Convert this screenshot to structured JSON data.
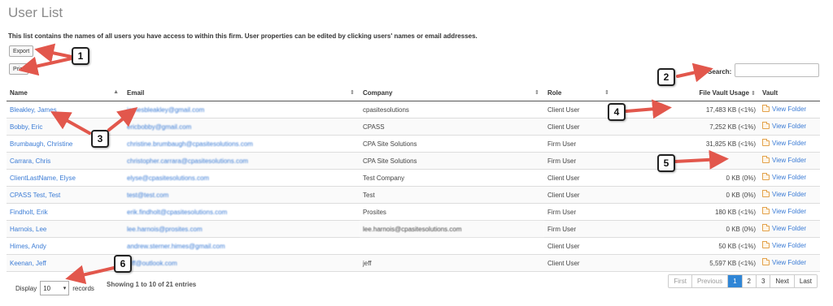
{
  "page": {
    "title": "User List",
    "description": "This list contains the names of all users you have access to within this firm. User properties can be edited by clicking users' names or email addresses."
  },
  "toolbar": {
    "export_label": "Export",
    "print_label": "Print"
  },
  "search": {
    "label": "Search:",
    "value": ""
  },
  "table": {
    "columns": [
      "Name",
      "Email",
      "Company",
      "Role",
      "File Vault Usage",
      "Vault"
    ],
    "rows": [
      {
        "name": "Bleakley, James",
        "email": "jamesbleakley@gmail.com",
        "company": "cpasitesolutions",
        "role": "Client User",
        "usage": "17,483 KB (<1%)",
        "vault": "View Folder"
      },
      {
        "name": "Bobby, Eric",
        "email": "ericbobby@gmail.com",
        "company": "CPASS",
        "role": "Client User",
        "usage": "7,252 KB (<1%)",
        "vault": "View Folder"
      },
      {
        "name": "Brumbaugh, Christine",
        "email": "christine.brumbaugh@cpasitesolutions.com",
        "company": "CPA Site Solutions",
        "role": "Firm User",
        "usage": "31,825 KB (<1%)",
        "vault": "View Folder"
      },
      {
        "name": "Carrara, Chris",
        "email": "christopher.carrara@cpasitesolutions.com",
        "company": "CPA Site Solutions",
        "role": "Firm User",
        "usage": "",
        "vault": "View Folder"
      },
      {
        "name": "ClientLastName, Elyse",
        "email": "elyse@cpasitesolutions.com",
        "company": "Test Company",
        "role": "Client User",
        "usage": "0 KB (0%)",
        "vault": "View Folder"
      },
      {
        "name": "CPASS Test, Test",
        "email": "test@test.com",
        "company": "Test",
        "role": "Client User",
        "usage": "0 KB (0%)",
        "vault": "View Folder"
      },
      {
        "name": "Findholt, Erik",
        "email": "erik.findholt@cpasitesolutions.com",
        "company": "Prosites",
        "role": "Firm User",
        "usage": "180 KB (<1%)",
        "vault": "View Folder"
      },
      {
        "name": "Harnois, Lee",
        "email": "lee.harnois@prosites.com",
        "company": "lee.harnois@cpasitesolutions.com",
        "role": "Firm User",
        "usage": "0 KB (0%)",
        "vault": "View Folder"
      },
      {
        "name": "Himes, Andy",
        "email": "andrew.sterner.himes@gmail.com",
        "company": "",
        "role": "Client User",
        "usage": "50 KB (<1%)",
        "vault": "View Folder"
      },
      {
        "name": "Keenan, Jeff",
        "email": "jeff@outlook.com",
        "company": "jeff",
        "role": "Client User",
        "usage": "5,597 KB (<1%)",
        "vault": "View Folder"
      }
    ]
  },
  "footer": {
    "display_label": "Display",
    "length_value": "10",
    "records_label": "records",
    "info": "Showing 1 to 10 of 21 entries"
  },
  "pagination": [
    "First",
    "Previous",
    "1",
    "2",
    "3",
    "Next",
    "Last"
  ],
  "callouts": [
    "1",
    "2",
    "3",
    "4",
    "5",
    "6"
  ],
  "colors": {
    "link": "#3a7bd5",
    "active_page": "#2f86d6",
    "arrow": "#e2574c"
  }
}
